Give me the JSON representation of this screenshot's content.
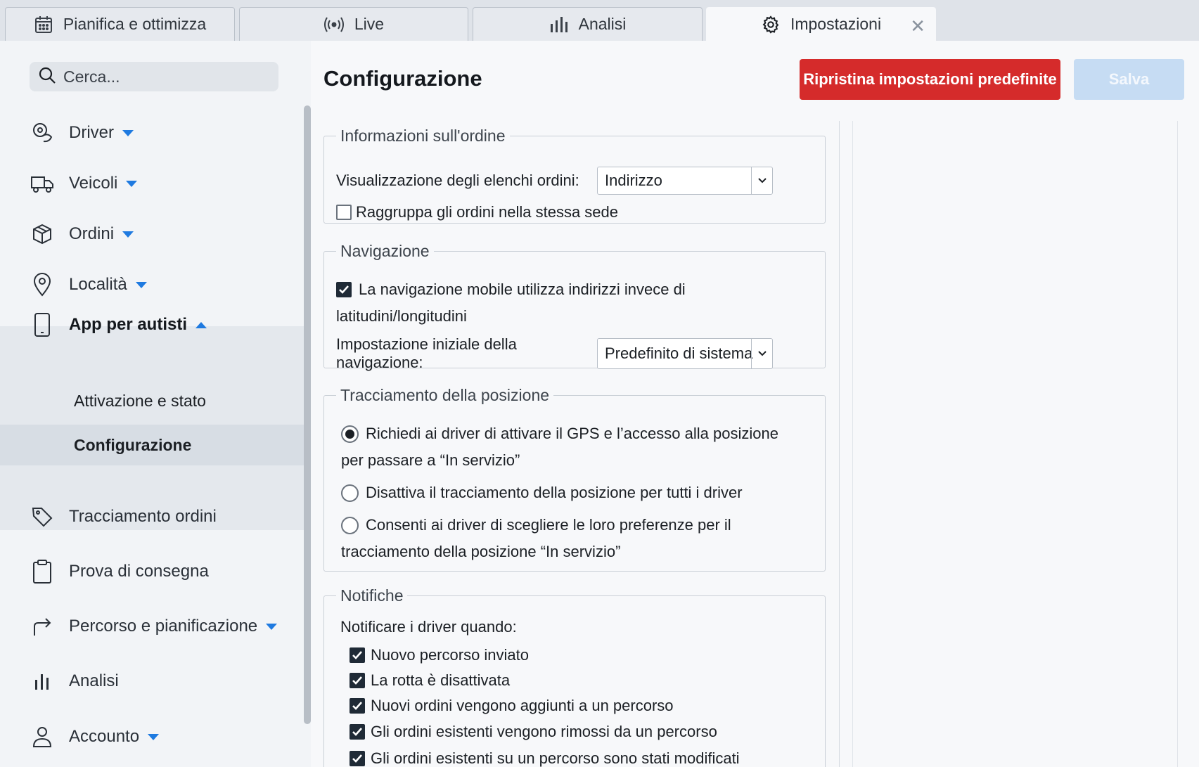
{
  "tabs": [
    {
      "label": "Pianifica e ottimizza",
      "icon": "calendar-icon"
    },
    {
      "label": "Live",
      "icon": "broadcast-icon"
    },
    {
      "label": "Analisi",
      "icon": "bar-chart-icon"
    },
    {
      "label": "Impostazioni",
      "icon": "gear-icon",
      "active": true
    }
  ],
  "tab_close": "✕",
  "search": {
    "placeholder": "Cerca..."
  },
  "sidebar": {
    "items": [
      {
        "label": "Driver",
        "icon": "driver-icon"
      },
      {
        "label": "Veicoli",
        "icon": "truck-icon"
      },
      {
        "label": "Ordini",
        "icon": "box-icon"
      },
      {
        "label": "Località",
        "icon": "location-pin-icon"
      },
      {
        "label": "App per autisti",
        "icon": "smartphone-icon",
        "expanded": true
      },
      {
        "label": "Tracciamento ordini",
        "icon": "tag-icon"
      },
      {
        "label": "Prova di consegna",
        "icon": "clipboard-icon"
      },
      {
        "label": "Percorso e pianificazione",
        "icon": "route-arrow-icon"
      },
      {
        "label": "Analisi",
        "icon": "bar-chart-icon"
      },
      {
        "label": "Accounto",
        "icon": "user-icon"
      }
    ],
    "subitems": [
      {
        "label": "Attivazione e stato"
      },
      {
        "label": "Configurazione",
        "active": true
      }
    ]
  },
  "main": {
    "title": "Configurazione",
    "reset_label": "Ripristina impostazioni predefinite",
    "save_label": "Salva",
    "colors": {
      "reset": "#d52b2b",
      "save_disabled": "#c6dcf3",
      "accent": "#1f7ae0"
    },
    "order_info": {
      "legend": "Informazioni sull'ordine",
      "list_view_label": "Visualizzazione degli elenchi ordini:",
      "list_view_value": "Indirizzo",
      "group_label": "Raggruppa gli ordini nella stessa sede",
      "group_checked": false
    },
    "navigation": {
      "legend": "Navigazione",
      "use_address_line1": "La navigazione mobile utilizza indirizzi invece di",
      "use_address_line2": "latitudini/longitudini",
      "use_address_checked": true,
      "initial_label": "Impostazione iniziale della navigazione:",
      "initial_value": "Predefinito di sistema"
    },
    "tracking": {
      "legend": "Tracciamento della posizione",
      "options": [
        {
          "line1": "Richiedi ai driver di attivare il GPS e l’accesso alla posizione",
          "line2": "per passare a “In servizio”",
          "checked": true
        },
        {
          "line1": "Disattiva il tracciamento della posizione per tutti i driver",
          "line2": "",
          "checked": false
        },
        {
          "line1": "Consenti ai driver di scegliere le loro preferenze per il",
          "line2": "tracciamento della posizione “In servizio”",
          "checked": false
        }
      ]
    },
    "notifications": {
      "legend": "Notifiche",
      "intro": "Notificare i driver quando:",
      "items": [
        {
          "label": "Nuovo percorso inviato",
          "checked": true
        },
        {
          "label": "La rotta è disattivata",
          "checked": true
        },
        {
          "label": "Nuovi ordini vengono aggiunti a un percorso",
          "checked": true
        },
        {
          "label": "Gli ordini esistenti vengono rimossi da un percorso",
          "checked": true
        },
        {
          "label": "Gli ordini esistenti su un percorso sono stati modificati",
          "checked": true
        }
      ]
    }
  }
}
